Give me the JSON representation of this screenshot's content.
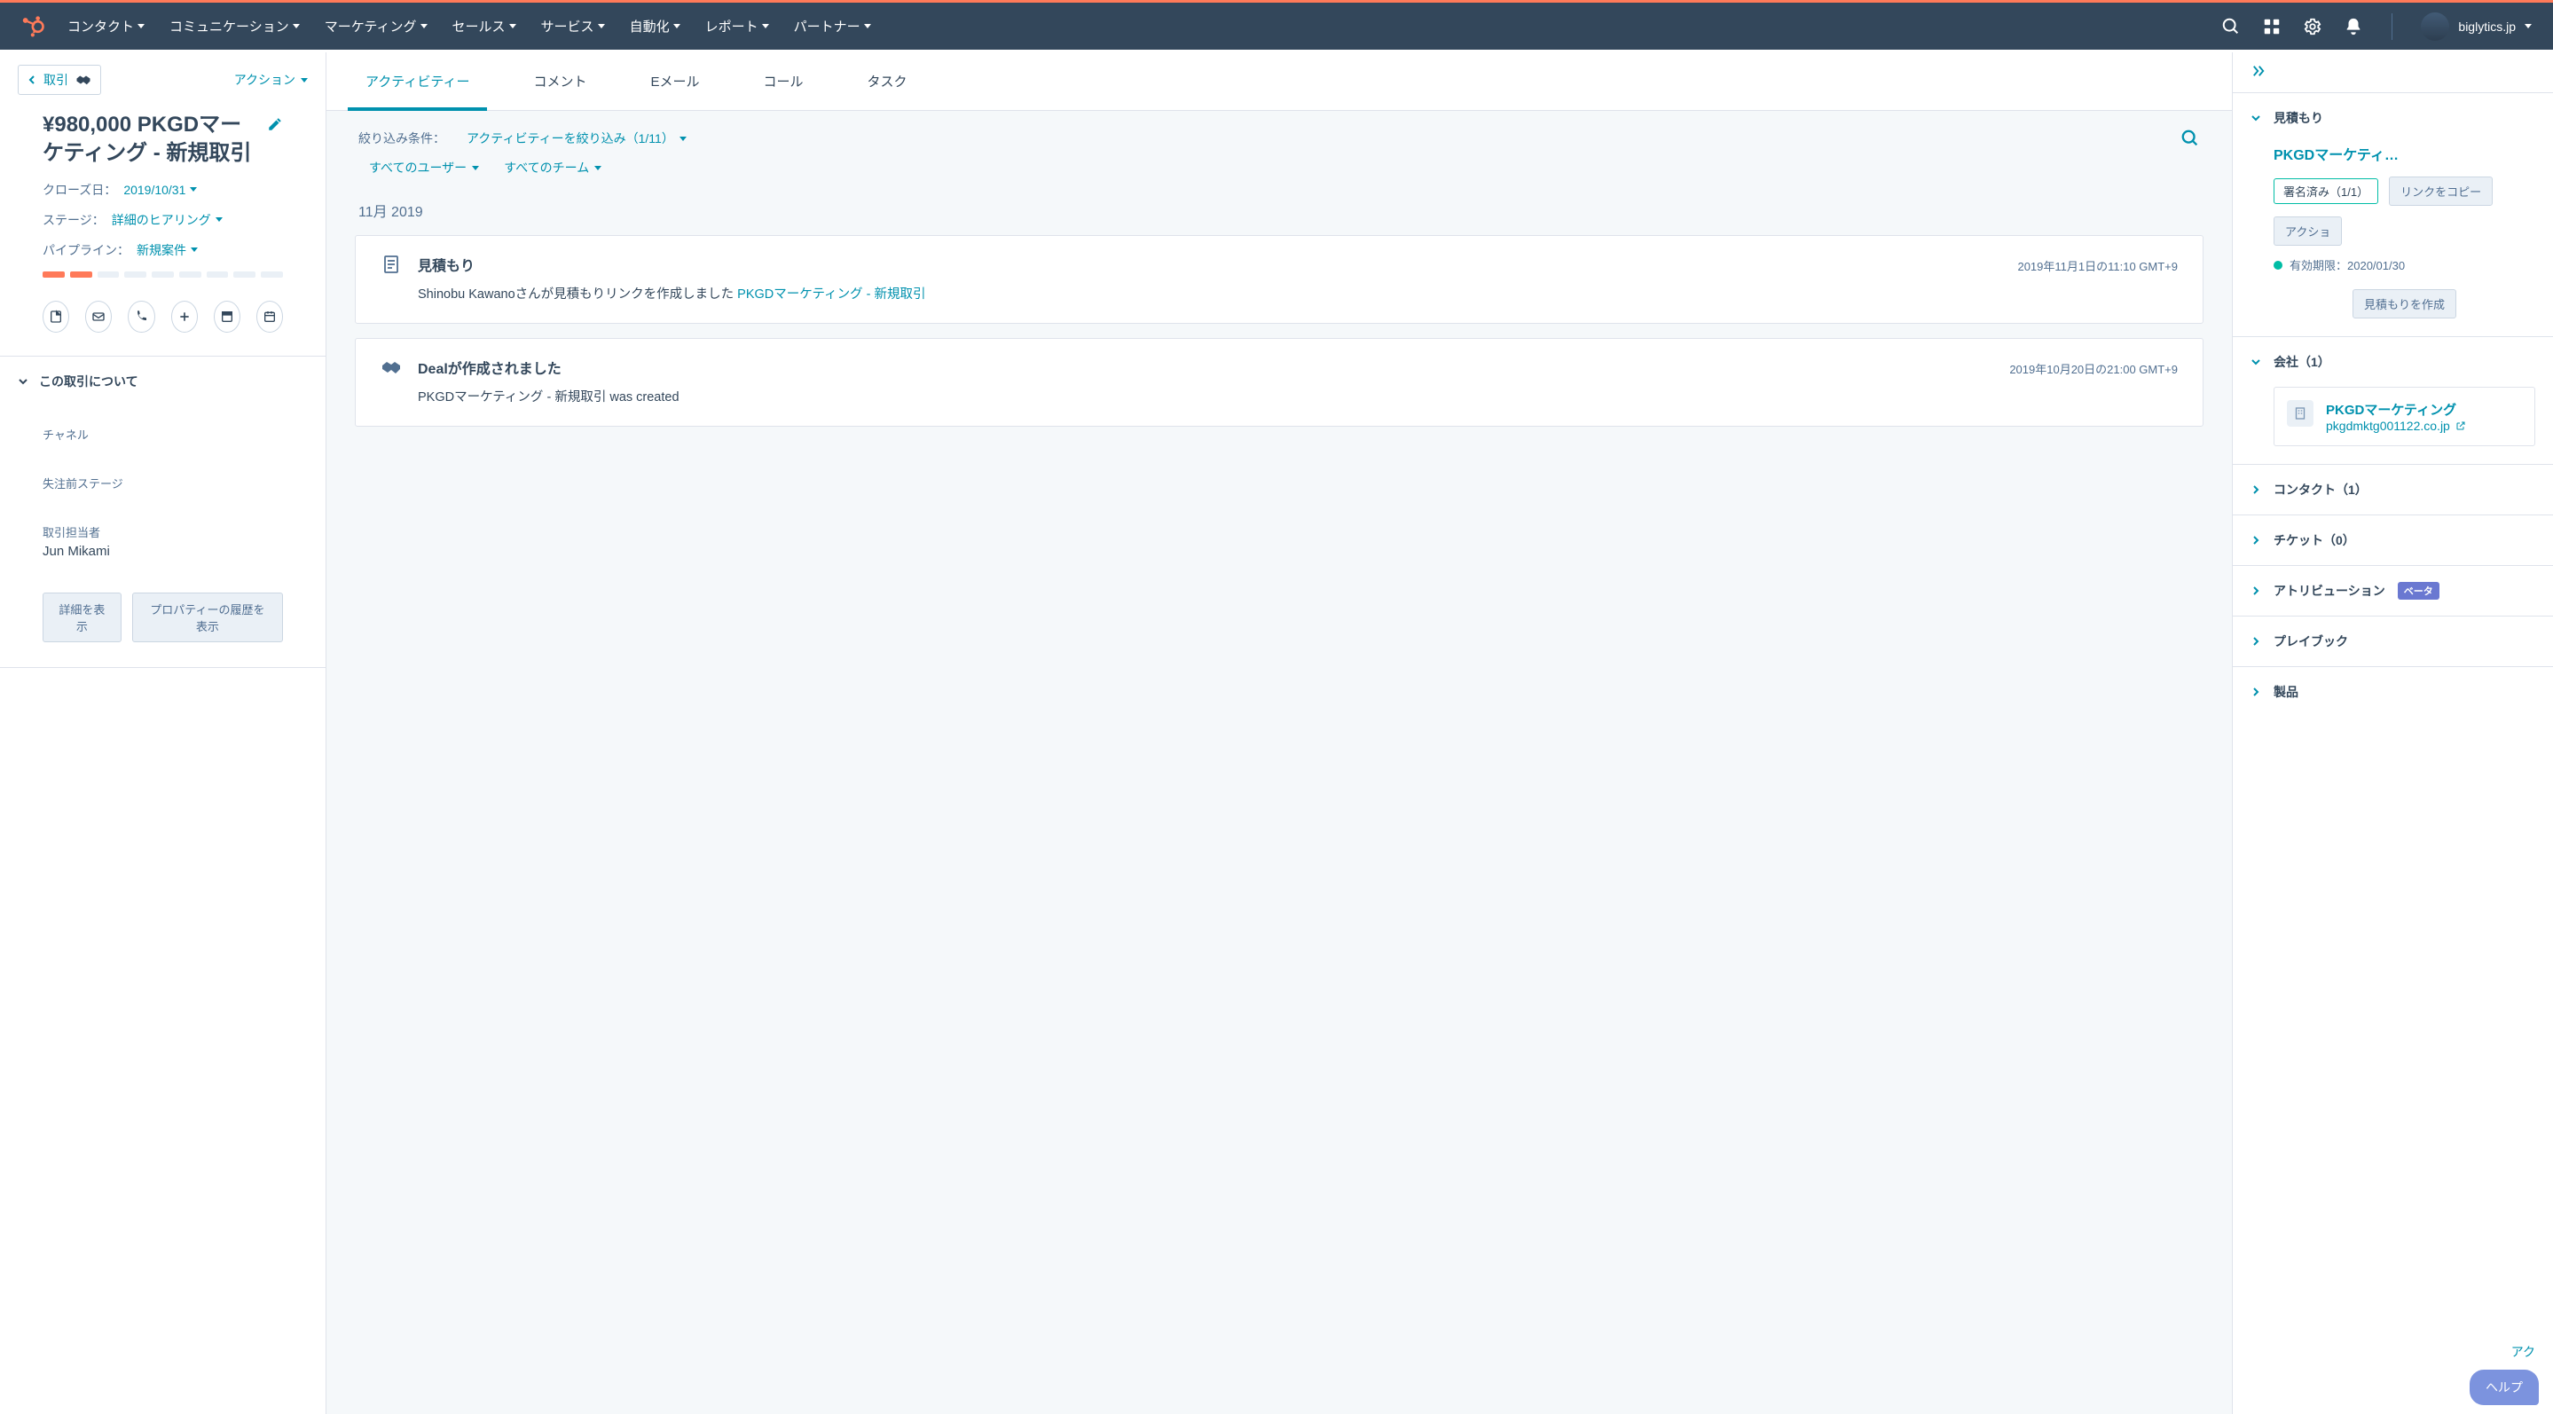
{
  "navbar": {
    "items": [
      "コンタクト",
      "コミュニケーション",
      "マーケティング",
      "セールス",
      "サービス",
      "自動化",
      "レポート",
      "パートナー"
    ],
    "user_name": "biglytics.jp"
  },
  "left": {
    "back_label": "取引",
    "action_label": "アクション",
    "title": "¥980,000 PKGDマーケティング - 新規取引",
    "close_date_label": "クローズ日：",
    "close_date": "2019/10/31",
    "stage_label": "ステージ：",
    "stage": "詳細のヒアリング",
    "pipeline_label": "パイプライン：",
    "pipeline": "新規案件",
    "about_header": "この取引について",
    "fields": {
      "channel_label": "チャネル",
      "lost_stage_label": "失注前ステージ",
      "owner_label": "取引担当者",
      "owner_value": "Jun Mikami"
    },
    "btn_details": "詳細を表示",
    "btn_history": "プロパティーの履歴を表示"
  },
  "center": {
    "tabs": [
      "アクティビティー",
      "コメント",
      "Eメール",
      "コール",
      "タスク"
    ],
    "filter_label": "絞り込み条件：",
    "filter_activity": "アクティビティーを絞り込み（1/11）",
    "filter_users": "すべてのユーザー",
    "filter_teams": "すべてのチーム",
    "month_label": "11月 2019",
    "cards": [
      {
        "icon": "quote",
        "title": "見積もり",
        "time": "2019年11月1日の11:10 GMT+9",
        "body_pre": "Shinobu Kawanoさんが見積もりリンクを作成しました ",
        "body_link": "PKGDマーケティング - 新規取引"
      },
      {
        "icon": "deal",
        "title": "Dealが作成されました",
        "time": "2019年10月20日の21:00 GMT+9",
        "body_pre": "PKGDマーケティング - 新規取引 was created",
        "body_link": ""
      }
    ]
  },
  "right": {
    "quote": {
      "header": "見積もり",
      "title": "PKGDマーケティ…",
      "status": "署名済み（1/1）",
      "btn_copy": "リンクをコピー",
      "btn_action": "アクショ",
      "expiry": "有効期限：2020/01/30",
      "btn_create": "見積もりを作成"
    },
    "company": {
      "header": "会社（1）",
      "name": "PKGDマーケティング",
      "domain": "pkgdmktg001122.co.jp"
    },
    "sections": [
      "コンタクト（1）",
      "チケット（0）",
      "アトリビューション",
      "プレイブック",
      "製品"
    ],
    "beta_label": "ベータ",
    "action_link": "アク",
    "help_label": "ヘルプ"
  }
}
